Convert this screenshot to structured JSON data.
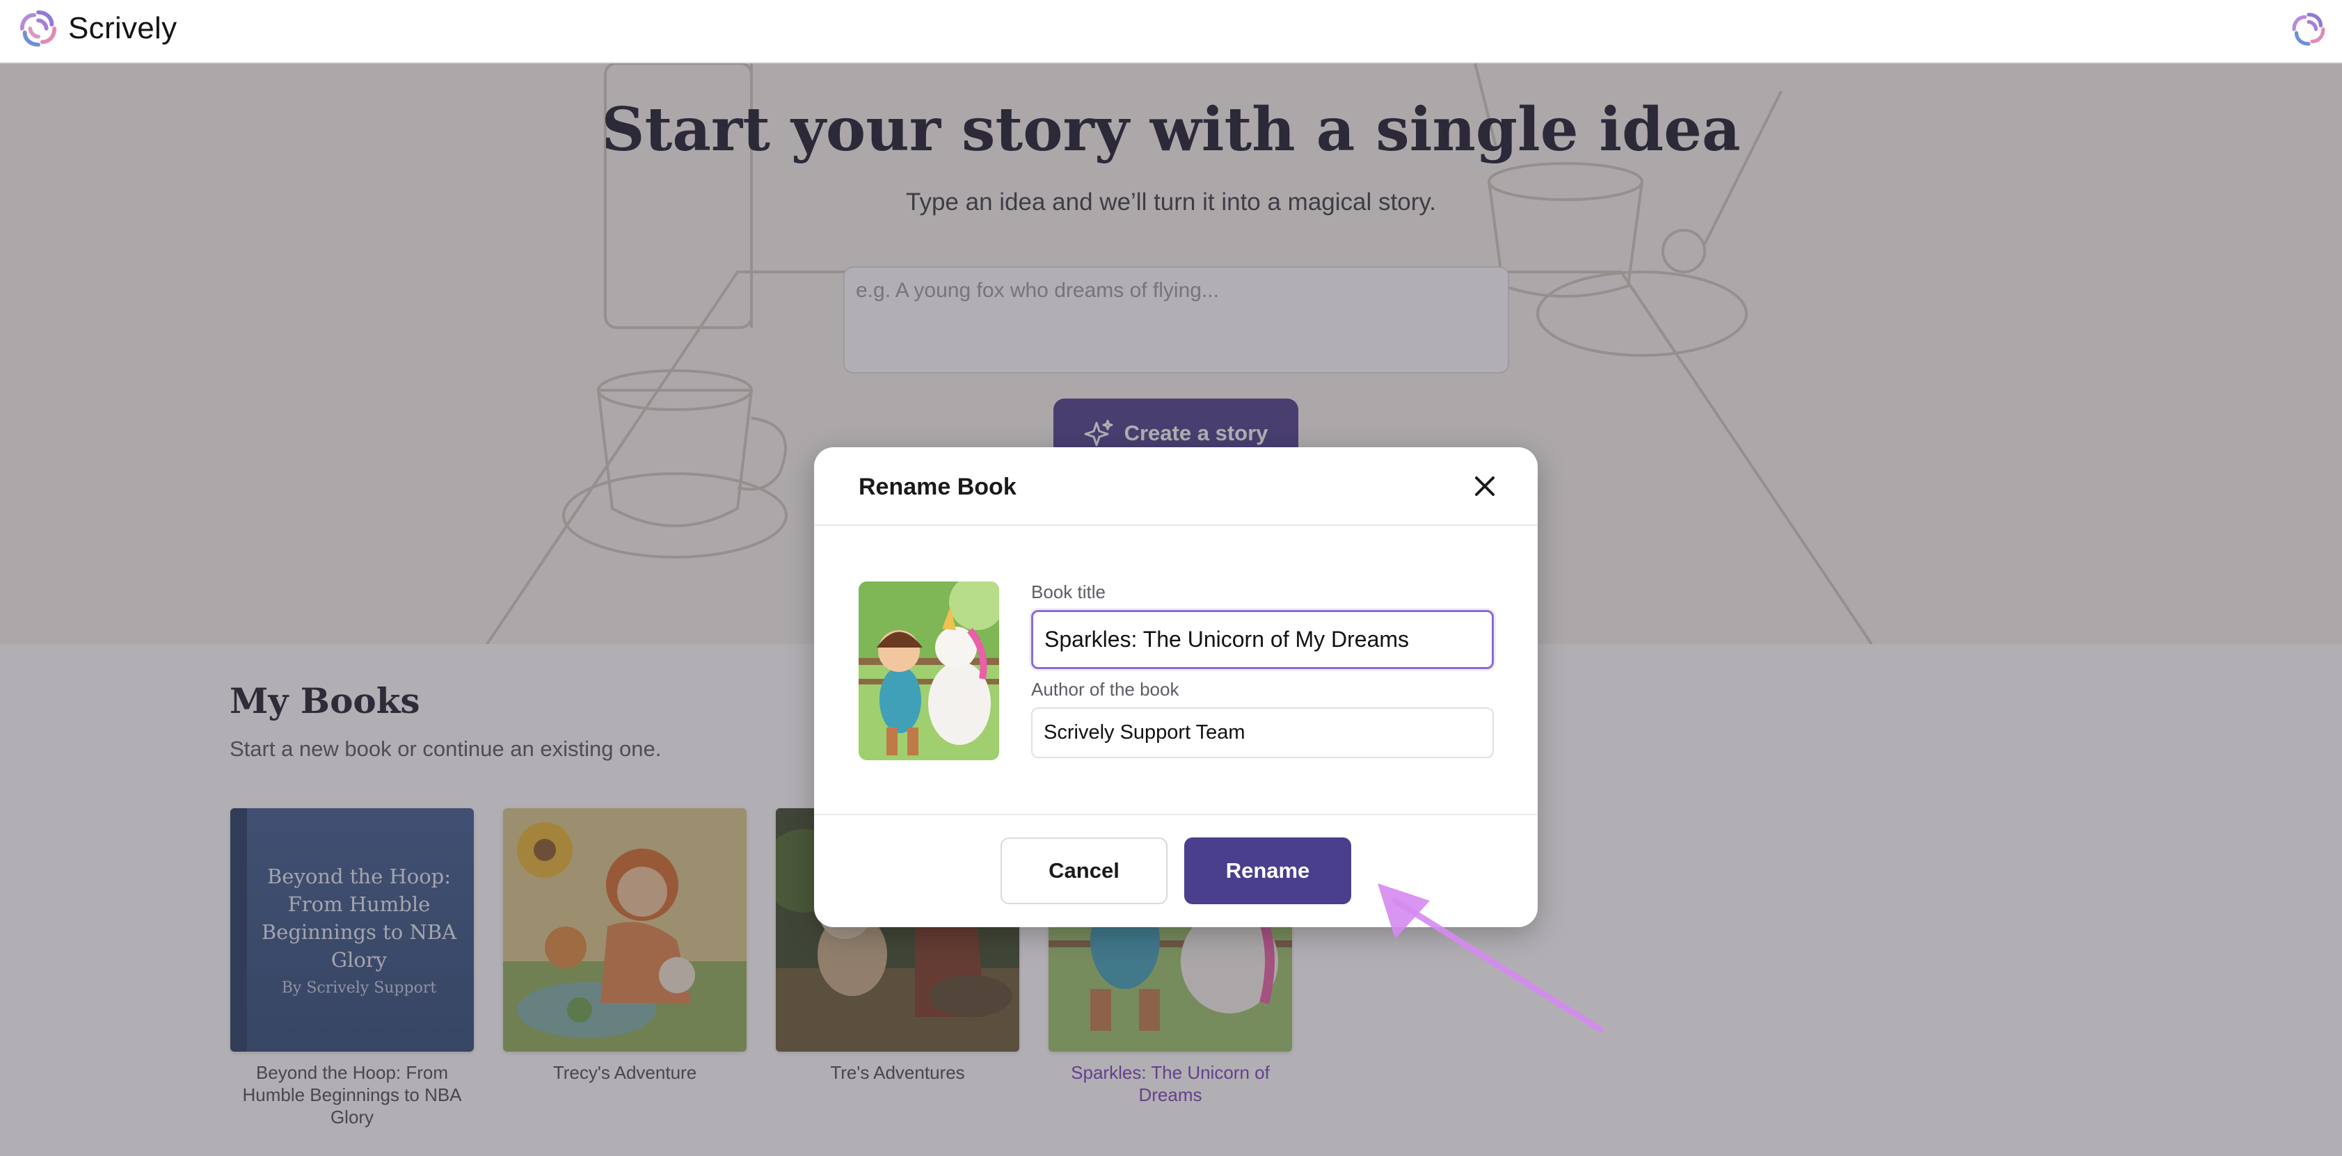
{
  "app": {
    "name": "Scrively"
  },
  "hero": {
    "title": "Start your story with a single idea",
    "subtitle": "Type an idea and we’ll turn it into a magical story.",
    "idea_placeholder": "e.g. A young fox who dreams of flying...",
    "create_button": "Create a story"
  },
  "books": {
    "title": "My Books",
    "subtitle": "Start a new book or continue an existing one.",
    "items": [
      {
        "label": "Beyond the Hoop: From Humble Beginnings to NBA Glory",
        "cover_title": "Beyond the Hoop: From Humble Beginnings to NBA Glory",
        "cover_author": "By Scrively Support"
      },
      {
        "label": "Trecy's Adventure"
      },
      {
        "label": "Tre's Adventures"
      },
      {
        "label": "Sparkles: The Unicorn of Dreams"
      }
    ]
  },
  "modal": {
    "title": "Rename Book",
    "book_title_label": "Book title",
    "book_title_value": "Sparkles: The Unicorn of My Dreams",
    "author_label": "Author of the book",
    "author_value": "Scrively Support Team",
    "cancel_button": "Cancel",
    "rename_button": "Rename"
  },
  "colors": {
    "brand": "#4a3f8c",
    "focus_border": "#8a6bd1",
    "active_book_label": "#7b3fbf",
    "annotation_arrow": "#d58af0"
  },
  "icons": [
    "scrively-logo-icon",
    "sparkle-icon",
    "close-icon",
    "avatar-icon"
  ]
}
